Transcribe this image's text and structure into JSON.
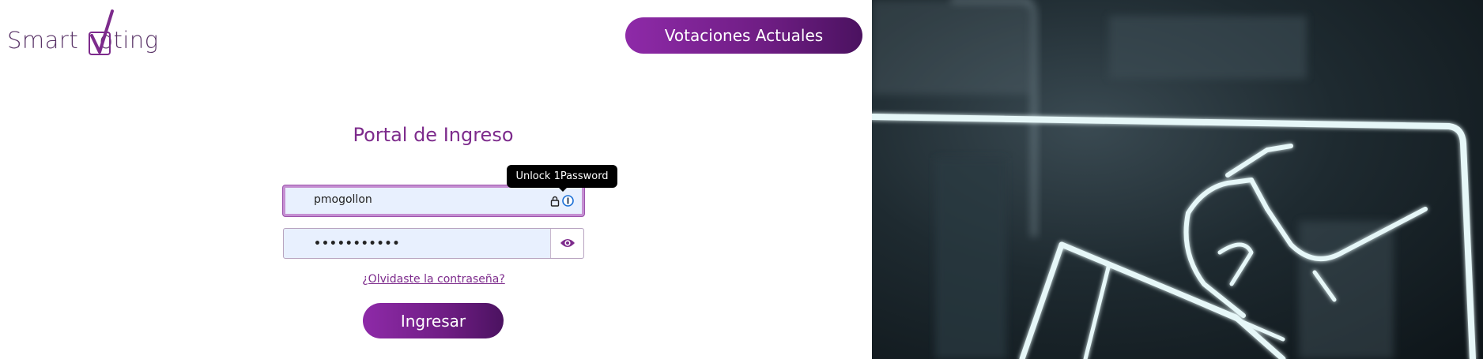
{
  "header": {
    "logo_text": "Smart",
    "logo_text_suffix": "oting",
    "nav_button_label": "Votaciones Actuales"
  },
  "login": {
    "title": "Portal de Ingreso",
    "username_value": "pmogollon",
    "password_value": "•••••••••••",
    "tooltip": "Unlock 1Password",
    "forgot_link": "¿Olvidaste la contraseña?",
    "submit_label": "Ingresar"
  },
  "colors": {
    "brand_purple": "#7d2b8c",
    "button_gradient_start": "#8e2aa8",
    "button_gradient_end": "#4b1260",
    "field_background": "#e8f0fe"
  },
  "icons": [
    "smartvoting-check-logo",
    "lock-icon",
    "1password-icon",
    "eye-icon"
  ]
}
